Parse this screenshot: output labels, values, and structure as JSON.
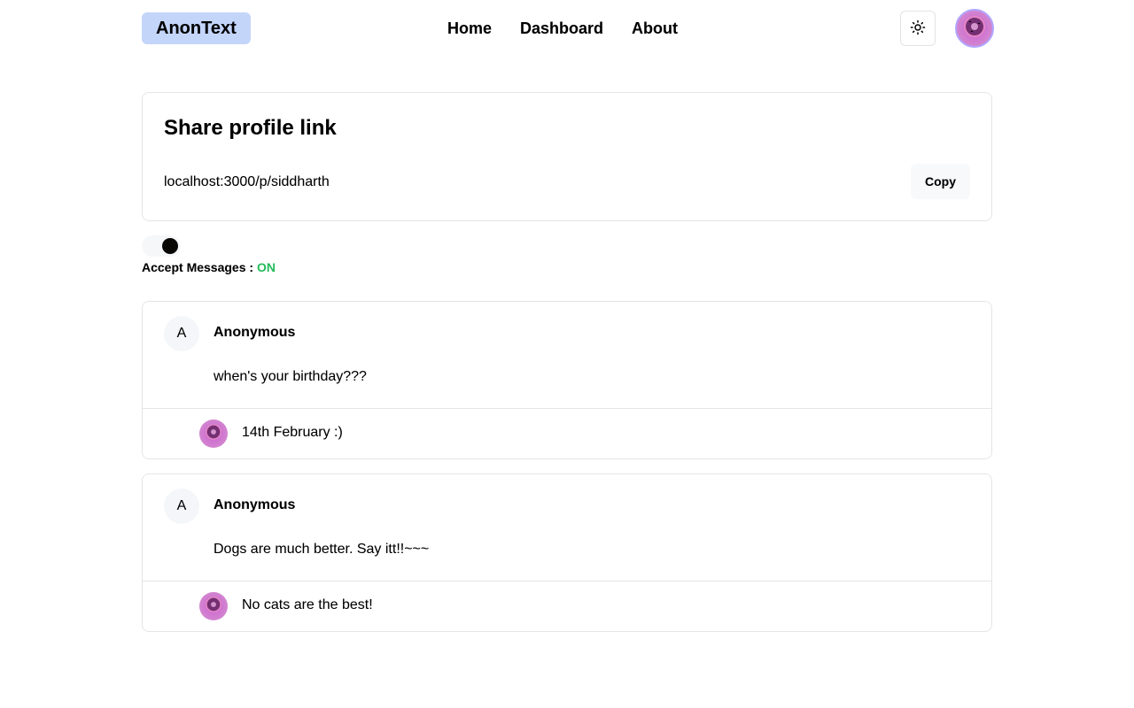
{
  "app": {
    "logo_text": "AnonText",
    "accent_color": "#c4d5fa"
  },
  "nav": {
    "items": [
      {
        "label": "Home"
      },
      {
        "label": "Dashboard"
      },
      {
        "label": "About"
      }
    ]
  },
  "header": {
    "theme_toggle_icon": "sun-icon",
    "avatar_icon": "donut-avatar-icon"
  },
  "share": {
    "title": "Share profile link",
    "link": "localhost:3000/p/siddharth",
    "copy_label": "Copy"
  },
  "accept": {
    "label": "Accept Messages : ",
    "status": "ON",
    "status_color": "#22c55e"
  },
  "messages": [
    {
      "avatar_letter": "A",
      "author": "Anonymous",
      "text": "when's your birthday???",
      "reply": "14th February :)"
    },
    {
      "avatar_letter": "A",
      "author": "Anonymous",
      "text": "Dogs are much better. Say itt!!~~~",
      "reply": "No cats are the best!"
    }
  ]
}
